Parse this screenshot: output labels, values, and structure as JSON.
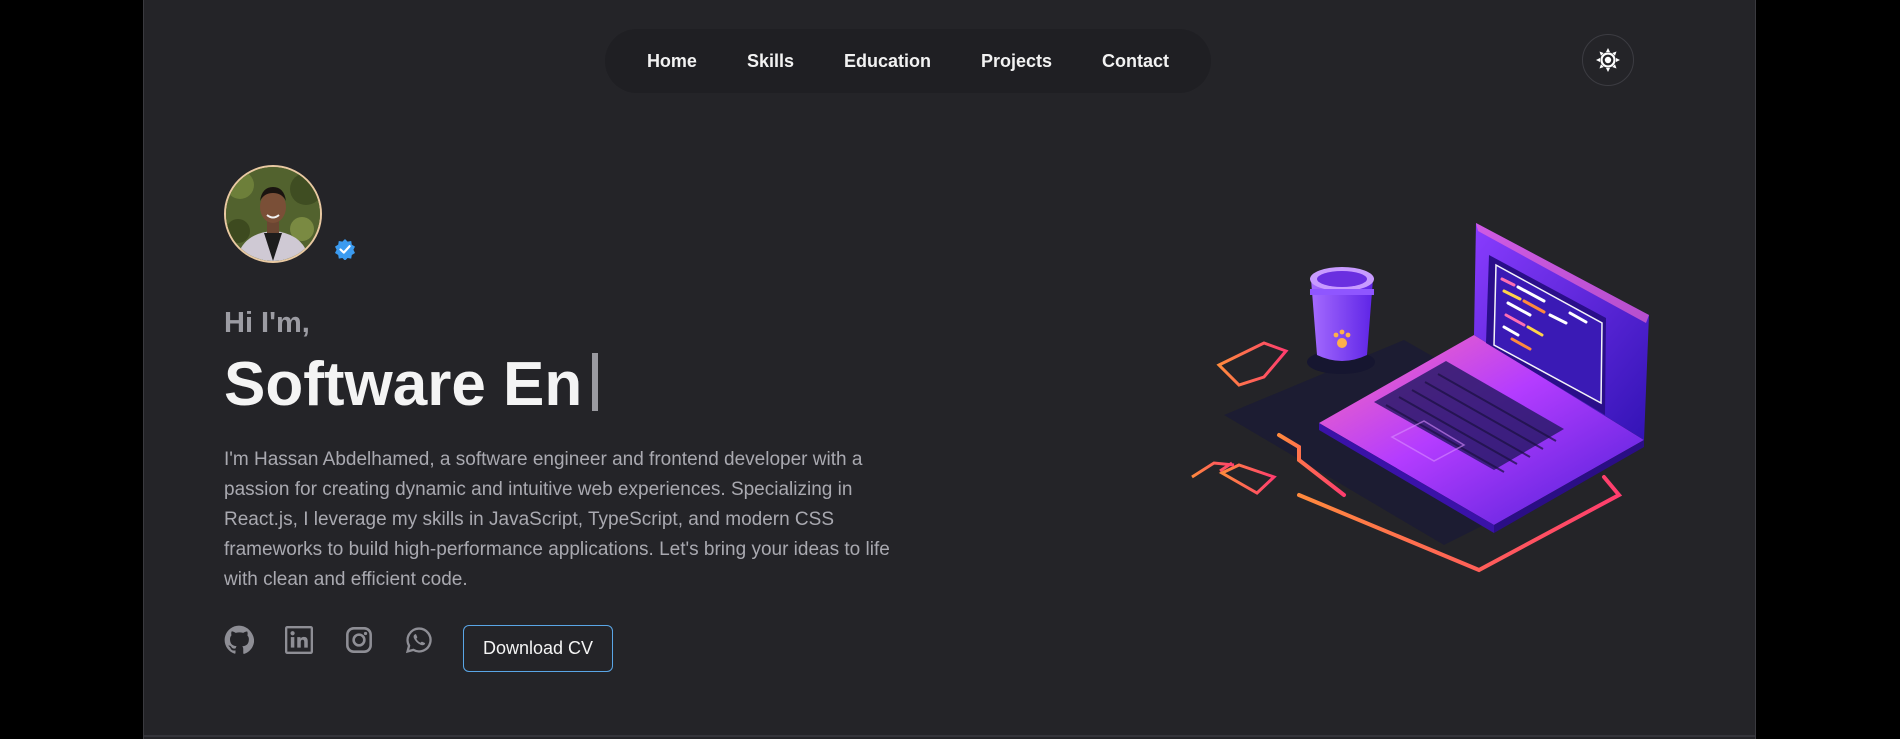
{
  "nav": {
    "items": [
      {
        "label": "Home"
      },
      {
        "label": "Skills"
      },
      {
        "label": "Education"
      },
      {
        "label": "Projects"
      },
      {
        "label": "Contact"
      }
    ]
  },
  "theme_toggle": {
    "icon": "sun-icon"
  },
  "hero": {
    "greeting": "Hi I'm,",
    "headline": "Software En",
    "bio": "I'm Hassan Abdelhamed, a software engineer and frontend developer with a passion for creating dynamic and intuitive web experiences. Specializing in React.js, I leverage my skills in JavaScript, TypeScript, and modern CSS frameworks to build high-performance applications. Let's bring your ideas to life with clean and efficient code.",
    "download_label": "Download CV"
  },
  "socials": [
    "github-icon",
    "linkedin-icon",
    "instagram-icon",
    "whatsapp-icon"
  ],
  "colors": {
    "background": "#242428",
    "accent_border": "#5aa6e6",
    "verified_badge": "#3b9bf0"
  }
}
